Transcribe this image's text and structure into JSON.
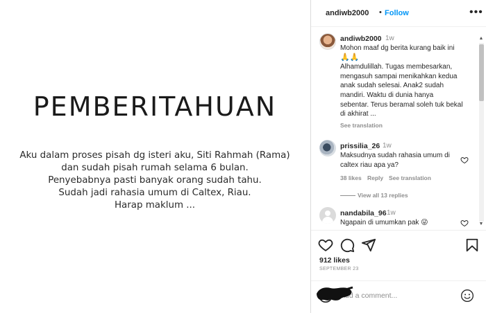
{
  "post": {
    "title": "PEMBERITAHUAN",
    "body_lines": [
      "Aku dalam proses pisah dg isteri aku, Siti Rahmah (Rama)",
      "dan sudah pisah rumah selama 6 bulan.",
      "Penyebabnya pasti banyak orang sudah tahu.",
      "Sudah jadi rahasia umum di Caltex, Riau.",
      "Harap maklum ..."
    ]
  },
  "header": {
    "username": "andiwb2000",
    "dot": "•",
    "follow_label": "Follow",
    "more_icon": "more-horizontal-icon",
    "more_glyph": "•••"
  },
  "comments": [
    {
      "username": "andiwb2000",
      "time": "1w",
      "text_lines": [
        "Mohon maaf dg berita kurang baik ini",
        "🙏🙏",
        "Alhamdulillah. Tugas membesarkan,",
        "mengasuh sampai menikahkan kedua",
        "anak sudah selesai. Anak2 sudah",
        "mandiri. Waktu di dunia hanya",
        "sebentar. Terus beramal soleh tuk bekal",
        "di akhirat ..."
      ],
      "see_translation": "See translation"
    },
    {
      "username": "prissilia_26",
      "time": "1w",
      "text_lines": [
        "Maksudnya sudah rahasia umum di",
        "caltex riau apa ya?"
      ],
      "likes": "38 likes",
      "reply": "Reply",
      "see_translation": "See translation"
    },
    {
      "username": "nandabila_96",
      "time": "1w",
      "text": "Ngapain di umumkan pak 😜"
    }
  ],
  "view_replies": "View all 13 replies",
  "scrollbar": {
    "up_glyph": "▲",
    "down_glyph": "▼"
  },
  "actions": {
    "likes": "912 likes",
    "date": "SEPTEMBER 23"
  },
  "add_comment": {
    "placeholder": "Add a comment..."
  },
  "colors": {
    "accent": "#0095f6",
    "text": "#262626",
    "muted": "#8e8e8e",
    "divider": "#efefef"
  }
}
